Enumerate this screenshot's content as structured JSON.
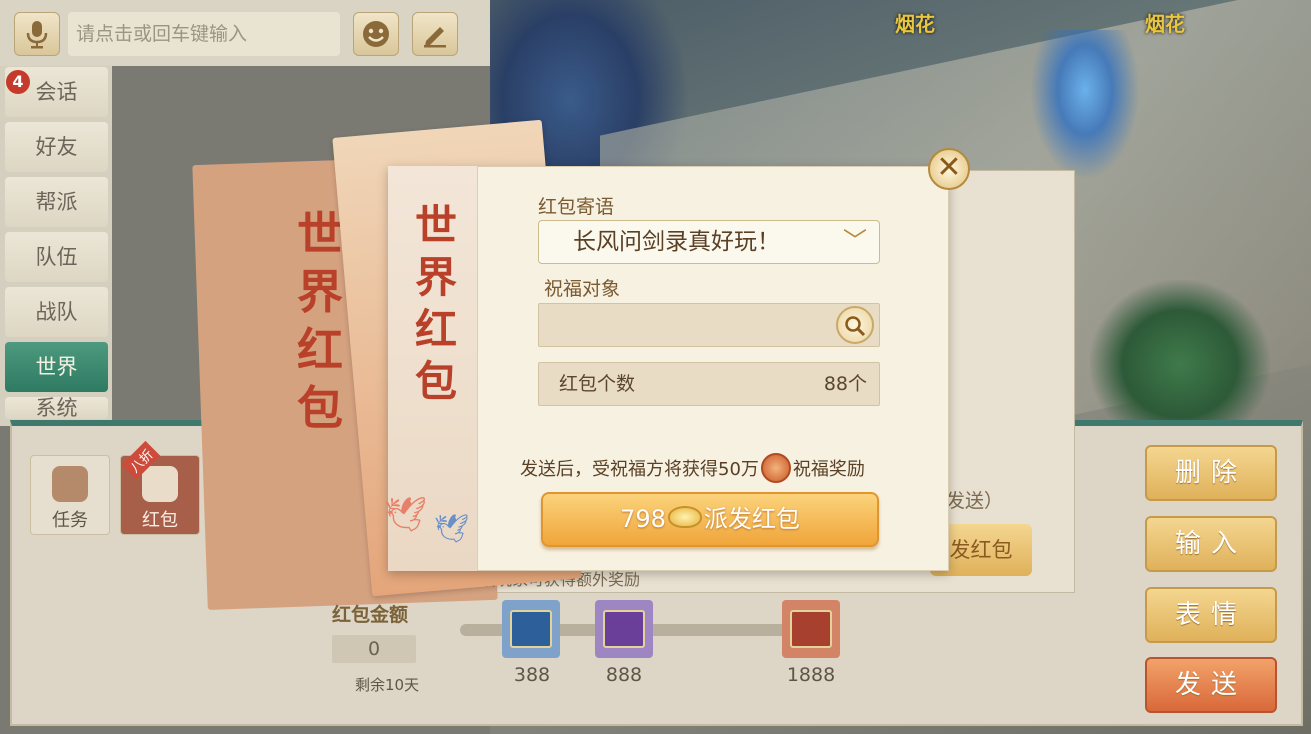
{
  "scene": {
    "firework_label_1": "烟花",
    "firework_label_2": "烟花"
  },
  "chat": {
    "placeholder": "请点击或回车键输入",
    "tabs": [
      {
        "label": "会话"
      },
      {
        "label": "好友"
      },
      {
        "label": "帮派"
      },
      {
        "label": "队伍"
      },
      {
        "label": "战队"
      },
      {
        "label": "世界"
      },
      {
        "label": "系统"
      }
    ],
    "unread_badge": "4",
    "active_tab": "世界"
  },
  "toolbar": {
    "task_label": "任务",
    "hongbao_label": "红包",
    "discount_tag": "八折"
  },
  "right_buttons": {
    "delete": "删除",
    "input": "输入",
    "emoji": "表情",
    "send": "发送"
  },
  "background_card": {
    "title": "世界红包",
    "faded_note": "获赠寄语玩家可获得额外奖励",
    "faded_paren": "发送）",
    "faded_button": "发红包",
    "amount_label": "红包金额",
    "amount_value": "0",
    "remaining": "剩余10天",
    "milestones": [
      "388",
      "888",
      "1888"
    ]
  },
  "modal": {
    "title": "世界红包",
    "message_label": "红包寄语",
    "message_value": "长风问剑录真好玩！",
    "target_label": "祝福对象",
    "target_value": "",
    "count_label": "红包个数",
    "count_value": "88个",
    "note_prefix": "发送后，受祝福方将获得50万",
    "note_suffix": "祝福奖励",
    "button_price": "798",
    "button_label": "派发红包"
  },
  "colors": {
    "accent_green": "#3d7a6d",
    "title_red": "#b9412a",
    "button_gold": "#f0a53a"
  }
}
